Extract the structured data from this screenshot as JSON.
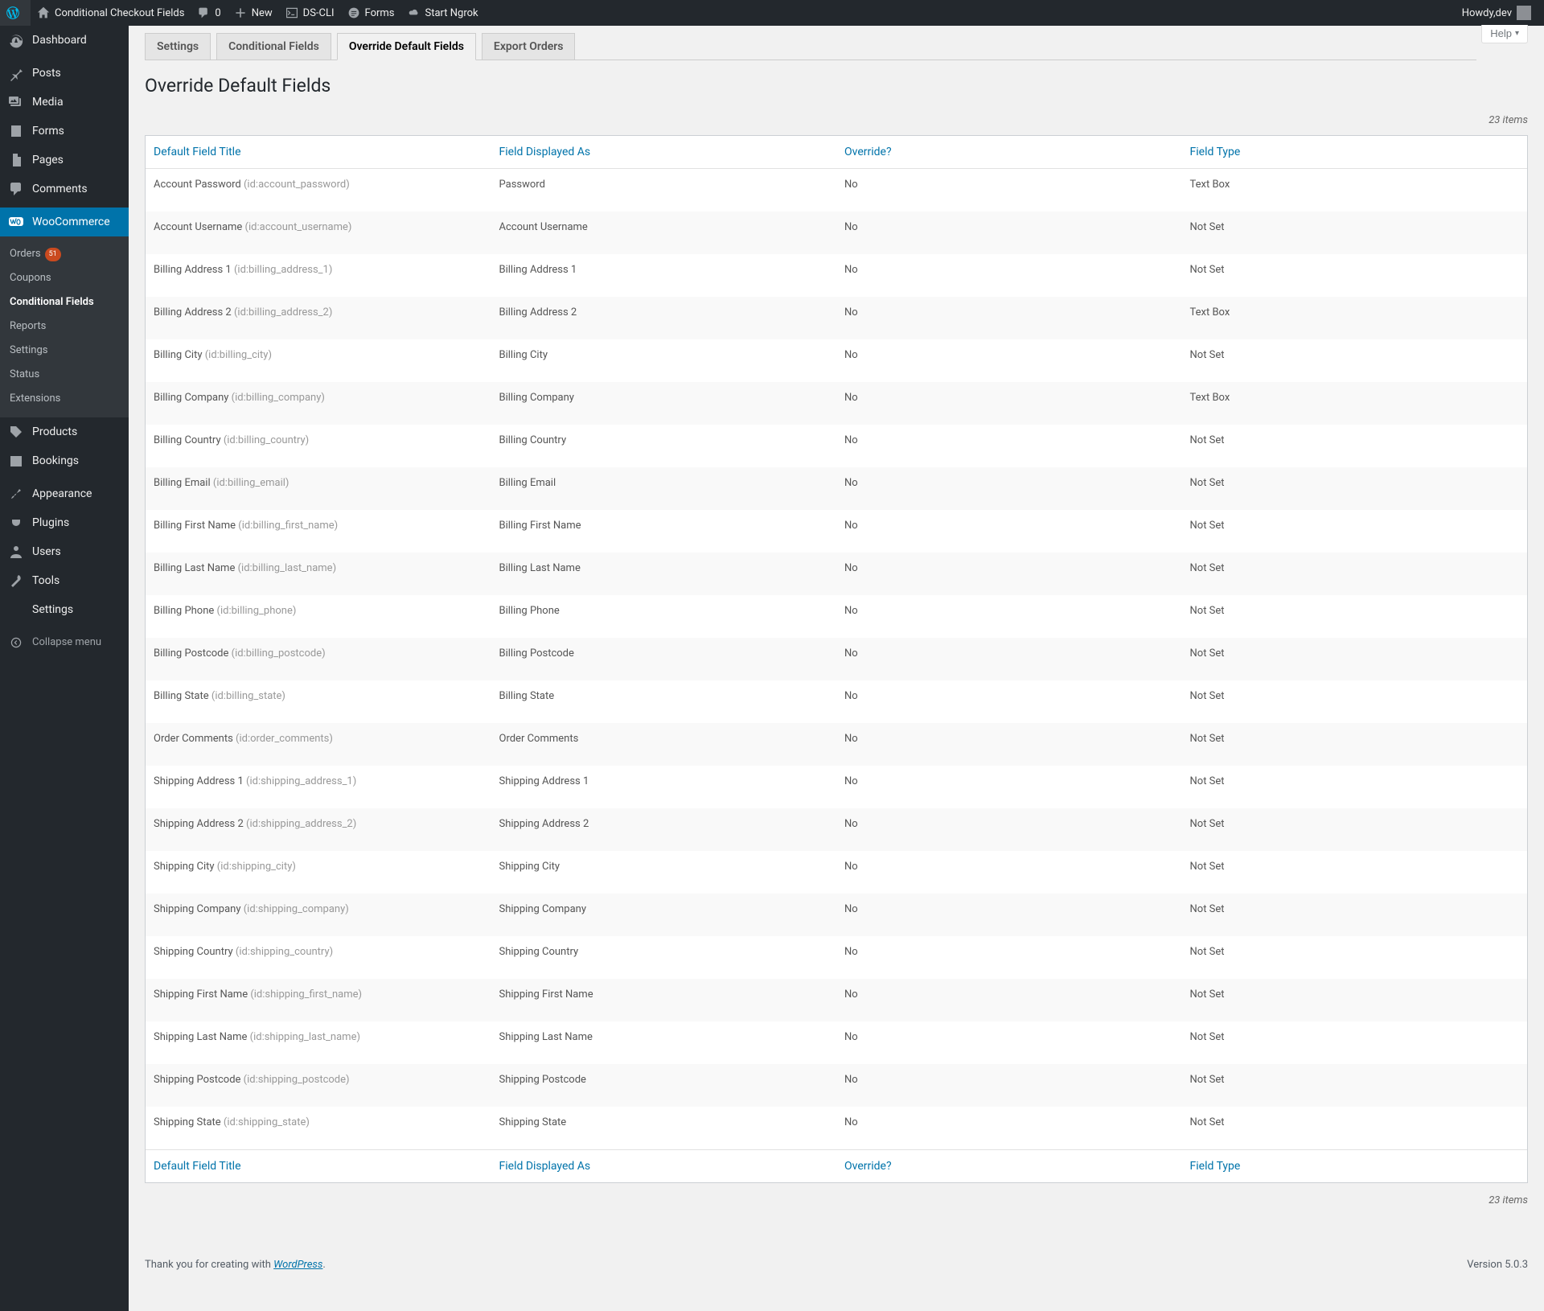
{
  "adminbar": {
    "site_name": "Conditional Checkout Fields",
    "comments_count": "0",
    "new_label": "New",
    "dscli_label": "DS-CLI",
    "forms_label": "Forms",
    "ngrok_label": "Start Ngrok",
    "howdy_prefix": "Howdy, ",
    "user_name": "dev"
  },
  "menu": {
    "dashboard": "Dashboard",
    "posts": "Posts",
    "media": "Media",
    "forms": "Forms",
    "pages": "Pages",
    "comments": "Comments",
    "woocommerce": "WooCommerce",
    "woo_sub": {
      "orders": "Orders",
      "orders_badge": "51",
      "coupons": "Coupons",
      "conditional_fields": "Conditional Fields",
      "reports": "Reports",
      "settings": "Settings",
      "status": "Status",
      "extensions": "Extensions"
    },
    "products": "Products",
    "bookings": "Bookings",
    "appearance": "Appearance",
    "plugins": "Plugins",
    "users": "Users",
    "tools": "Tools",
    "settings": "Settings",
    "collapse": "Collapse menu"
  },
  "help_label": "Help",
  "tabs": {
    "t0": "Settings",
    "t1": "Conditional Fields",
    "t2": "Override Default Fields",
    "t3": "Export Orders"
  },
  "page_title": "Override Default Fields",
  "items_count": "23 items",
  "columns": {
    "title": "Default Field Title",
    "displayed": "Field Displayed As",
    "override": "Override?",
    "type": "Field Type"
  },
  "rows": [
    {
      "title": "Account Password",
      "id": "(id:account_password)",
      "displayed": "Password",
      "override": "No",
      "type": "Text Box"
    },
    {
      "title": "Account Username",
      "id": "(id:account_username)",
      "displayed": "Account Username",
      "override": "No",
      "type": "Not Set"
    },
    {
      "title": "Billing Address 1",
      "id": "(id:billing_address_1)",
      "displayed": "Billing Address 1",
      "override": "No",
      "type": "Not Set"
    },
    {
      "title": "Billing Address 2",
      "id": "(id:billing_address_2)",
      "displayed": "Billing Address 2",
      "override": "No",
      "type": "Text Box"
    },
    {
      "title": "Billing City",
      "id": "(id:billing_city)",
      "displayed": "Billing City",
      "override": "No",
      "type": "Not Set"
    },
    {
      "title": "Billing Company",
      "id": "(id:billing_company)",
      "displayed": "Billing Company",
      "override": "No",
      "type": "Text Box"
    },
    {
      "title": "Billing Country",
      "id": "(id:billing_country)",
      "displayed": "Billing Country",
      "override": "No",
      "type": "Not Set"
    },
    {
      "title": "Billing Email",
      "id": "(id:billing_email)",
      "displayed": "Billing Email",
      "override": "No",
      "type": "Not Set"
    },
    {
      "title": "Billing First Name",
      "id": "(id:billing_first_name)",
      "displayed": "Billing First Name",
      "override": "No",
      "type": "Not Set"
    },
    {
      "title": "Billing Last Name",
      "id": "(id:billing_last_name)",
      "displayed": "Billing Last Name",
      "override": "No",
      "type": "Not Set"
    },
    {
      "title": "Billing Phone",
      "id": "(id:billing_phone)",
      "displayed": "Billing Phone",
      "override": "No",
      "type": "Not Set"
    },
    {
      "title": "Billing Postcode",
      "id": "(id:billing_postcode)",
      "displayed": "Billing Postcode",
      "override": "No",
      "type": "Not Set"
    },
    {
      "title": "Billing State",
      "id": "(id:billing_state)",
      "displayed": "Billing State",
      "override": "No",
      "type": "Not Set"
    },
    {
      "title": "Order Comments",
      "id": "(id:order_comments)",
      "displayed": "Order Comments",
      "override": "No",
      "type": "Not Set"
    },
    {
      "title": "Shipping Address 1",
      "id": "(id:shipping_address_1)",
      "displayed": "Shipping Address 1",
      "override": "No",
      "type": "Not Set"
    },
    {
      "title": "Shipping Address 2",
      "id": "(id:shipping_address_2)",
      "displayed": "Shipping Address 2",
      "override": "No",
      "type": "Not Set"
    },
    {
      "title": "Shipping City",
      "id": "(id:shipping_city)",
      "displayed": "Shipping City",
      "override": "No",
      "type": "Not Set"
    },
    {
      "title": "Shipping Company",
      "id": "(id:shipping_company)",
      "displayed": "Shipping Company",
      "override": "No",
      "type": "Not Set"
    },
    {
      "title": "Shipping Country",
      "id": "(id:shipping_country)",
      "displayed": "Shipping Country",
      "override": "No",
      "type": "Not Set"
    },
    {
      "title": "Shipping First Name",
      "id": "(id:shipping_first_name)",
      "displayed": "Shipping First Name",
      "override": "No",
      "type": "Not Set"
    },
    {
      "title": "Shipping Last Name",
      "id": "(id:shipping_last_name)",
      "displayed": "Shipping Last Name",
      "override": "No",
      "type": "Not Set"
    },
    {
      "title": "Shipping Postcode",
      "id": "(id:shipping_postcode)",
      "displayed": "Shipping Postcode",
      "override": "No",
      "type": "Not Set"
    },
    {
      "title": "Shipping State",
      "id": "(id:shipping_state)",
      "displayed": "Shipping State",
      "override": "No",
      "type": "Not Set"
    }
  ],
  "footer": {
    "thanks_prefix": "Thank you for creating with ",
    "wp_link": "WordPress",
    "thanks_suffix": ".",
    "version": "Version 5.0.3"
  }
}
